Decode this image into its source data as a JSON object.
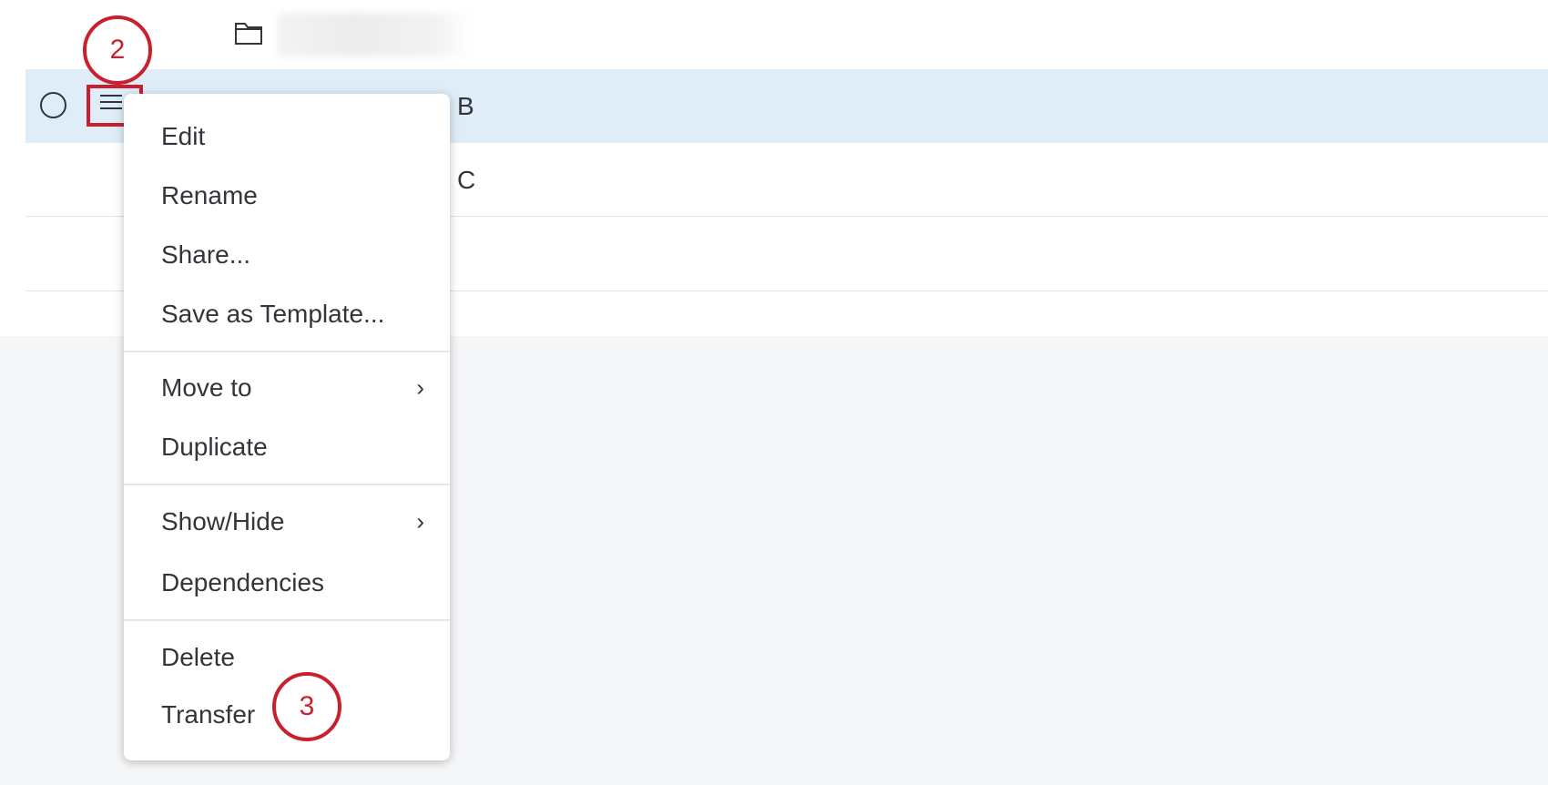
{
  "rows": {
    "folder": {
      "icon": "folder-icon"
    },
    "selected": {
      "value": "B"
    },
    "second": {
      "value": "C"
    }
  },
  "callouts": {
    "step2": "2",
    "step3": "3"
  },
  "menu": {
    "items": [
      {
        "label": "Edit"
      },
      {
        "label": "Rename"
      },
      {
        "label": "Share..."
      },
      {
        "label": "Save as Template..."
      },
      {
        "label": "Move to",
        "submenu": true
      },
      {
        "label": "Duplicate"
      },
      {
        "label": "Show/Hide",
        "submenu": true
      },
      {
        "label": "Dependencies"
      },
      {
        "label": "Delete"
      },
      {
        "label": "Transfer"
      }
    ],
    "chevron": "›"
  },
  "colors": {
    "selected_row": "#deedf8",
    "callout": "#c8202f",
    "background": "#f5f6f8"
  }
}
